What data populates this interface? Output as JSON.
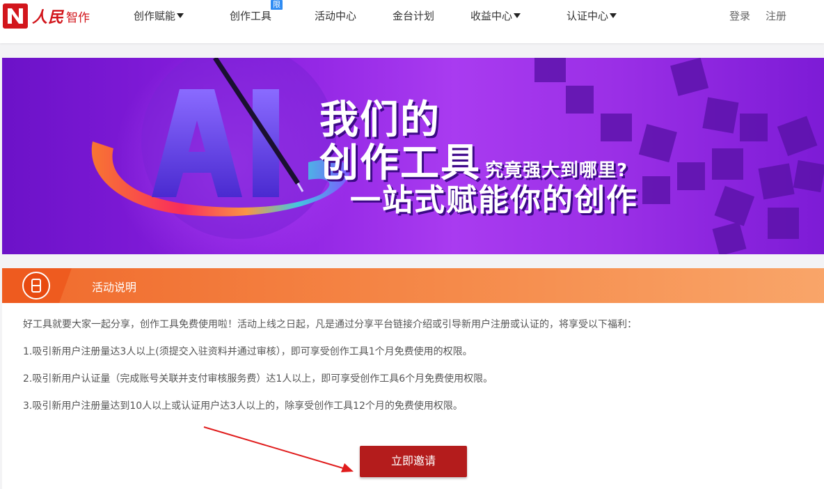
{
  "header": {
    "logo": {
      "text_brush": "人民",
      "text_plain": "智作"
    },
    "nav": [
      {
        "label": "创作赋能",
        "has_caret": true
      },
      {
        "label": "创作工具",
        "has_caret": false,
        "badge": "限时免费"
      },
      {
        "label": "活动中心",
        "has_caret": false
      },
      {
        "label": "金台计划",
        "has_caret": false
      },
      {
        "label": "收益中心",
        "has_caret": true
      },
      {
        "label": "认证中心",
        "has_caret": true
      }
    ],
    "login": "登录",
    "register": "注册"
  },
  "banner": {
    "line1": "我们的",
    "line2": "创作工具",
    "line2_small": "究竟强大到哪里?",
    "line3": "一站式赋能你的创作",
    "ai_text": "AI"
  },
  "activity": {
    "title": "活动说明",
    "paragraphs": [
      "好工具就要大家一起分享，创作工具免费使用啦！活动上线之日起，凡是通过分享平台链接介绍或引导新用户注册或认证的，将享受以下福利：",
      "1.吸引新用户注册量达3人以上(须提交入驻资料并通过审核），即可享受创作工具1个月免费使用的权限。",
      "2.吸引新用户认证量（完成账号关联并支付审核服务费）达1人以上，即可享受创作工具6个月免费使用权限。",
      "3.吸引新用户注册量达到10人以上或认证用户达3人以上的，除享受创作工具12个月的免费使用权限。"
    ],
    "invite_button": "立即邀请"
  },
  "colors": {
    "brand_red": "#d2161c",
    "badge_blue": "#2f8cf3",
    "header_orange": "#f06a2c",
    "button_red": "#b41c1c",
    "banner_purple": "#8a1fe0"
  }
}
